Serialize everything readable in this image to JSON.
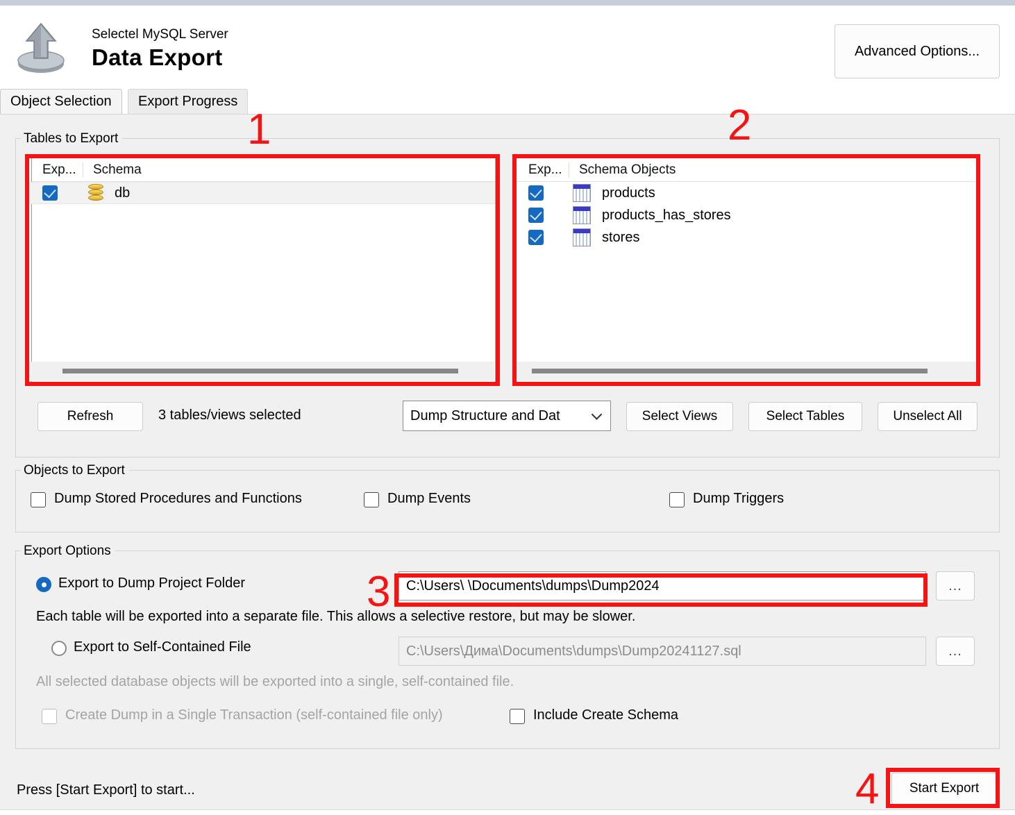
{
  "header": {
    "subtitle": "Selectel MySQL Server",
    "title": "Data Export",
    "icon": "export-upload-icon",
    "advanced_options_label": "Advanced Options..."
  },
  "tabs": [
    {
      "label": "Object Selection",
      "active": true
    },
    {
      "label": "Export Progress",
      "active": false
    }
  ],
  "tables_group": {
    "legend": "Tables to Export",
    "left_list": {
      "columns": [
        "Exp...",
        "Schema"
      ],
      "rows": [
        {
          "checked": true,
          "icon": "database-icon",
          "label": "db",
          "selected": true
        }
      ]
    },
    "right_list": {
      "columns": [
        "Exp...",
        "Schema Objects"
      ],
      "rows": [
        {
          "checked": true,
          "icon": "table-icon",
          "label": "products"
        },
        {
          "checked": true,
          "icon": "table-icon",
          "label": "products_has_stores"
        },
        {
          "checked": true,
          "icon": "table-icon",
          "label": "stores"
        }
      ]
    },
    "refresh_label": "Refresh",
    "selection_status": "3 tables/views selected",
    "dump_mode_selected": "Dump Structure and Dat",
    "select_views_label": "Select Views",
    "select_tables_label": "Select Tables",
    "unselect_all_label": "Unselect All"
  },
  "objects_group": {
    "legend": "Objects to Export",
    "checkboxes": [
      {
        "label": "Dump Stored Procedures and Functions",
        "checked": false,
        "disabled": false
      },
      {
        "label": "Dump Events",
        "checked": false,
        "disabled": false
      },
      {
        "label": "Dump Triggers",
        "checked": false,
        "disabled": false
      }
    ]
  },
  "export_options": {
    "legend": "Export Options",
    "project_folder": {
      "radio_label": "Export to Dump Project Folder",
      "selected": true,
      "path_value": "C:\\Users\\         \\Documents\\dumps\\Dump2024",
      "browse_label": "...",
      "hint": "Each table will be exported into a separate file. This allows a selective restore, but may be slower."
    },
    "self_contained": {
      "radio_label": "Export to Self-Contained File",
      "selected": false,
      "path_value": "C:\\Users\\Дима\\Documents\\dumps\\Dump20241127.sql",
      "browse_label": "...",
      "hint": "All selected database objects will be exported into a single, self-contained file."
    },
    "single_transaction": {
      "label": "Create Dump in a Single Transaction (self-contained file only)",
      "checked": false,
      "disabled": true
    },
    "include_create_schema": {
      "label": "Include Create Schema",
      "checked": false,
      "disabled": false
    }
  },
  "footer": {
    "status": "Press [Start Export] to start...",
    "start_export_label": "Start Export"
  },
  "annotations": [
    {
      "number": "1",
      "target": "left-tables-list"
    },
    {
      "number": "2",
      "target": "right-objects-list"
    },
    {
      "number": "3",
      "target": "dump-project-folder-path"
    },
    {
      "number": "4",
      "target": "start-export-button"
    }
  ],
  "colors": {
    "annotation_red": "#f51414",
    "accent_blue": "#1669c1",
    "panel_bg": "#f1f0f0"
  }
}
